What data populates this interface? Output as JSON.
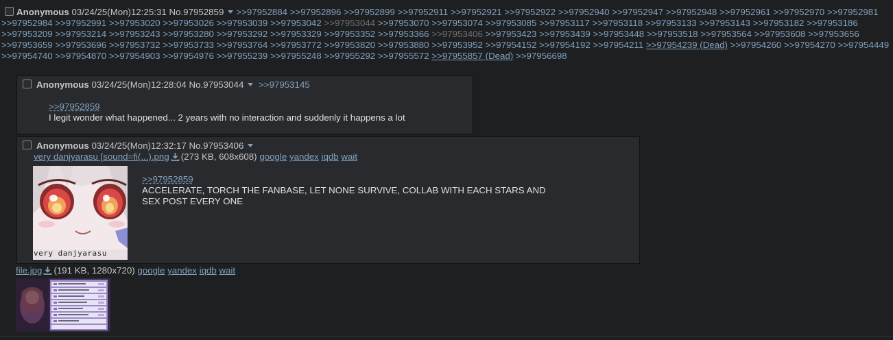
{
  "op": {
    "name": "Anonymous",
    "datetime": "03/24/25(Mon)12:25:31",
    "no": "No.97952859",
    "backlinks": [
      ">>97952884",
      ">>97952896",
      ">>97952899",
      ">>97952911",
      ">>97952921",
      ">>97952922",
      ">>97952940",
      ">>97952947",
      ">>97952948",
      ">>97952961",
      ">>97952970",
      ">>97952981",
      ">>97952984",
      ">>97952991",
      ">>97953020",
      ">>97953026",
      ">>97953039",
      ">>97953042",
      ">>97953044",
      ">>97953070",
      ">>97953074",
      ">>97953085",
      ">>97953117",
      ">>97953118",
      ">>97953133",
      ">>97953143",
      ">>97953182",
      ">>97953186",
      ">>97953209",
      ">>97953214",
      ">>97953243",
      ">>97953280",
      ">>97953292",
      ">>97953329",
      ">>97953352",
      ">>97953366",
      ">>97953406",
      ">>97953423",
      ">>97953439",
      ">>97953448",
      ">>97953518",
      ">>97953564",
      ">>97953608",
      ">>97953656",
      ">>97953659",
      ">>97953696",
      ">>97953732",
      ">>97953733",
      ">>97953764",
      ">>97953772",
      ">>97953820",
      ">>97953880",
      ">>97953952",
      ">>97954152",
      ">>97954192",
      ">>97954211",
      ">>97954239 (Dead)",
      ">>97954260",
      ">>97954270",
      ">>97954449",
      ">>97954740",
      ">>97954870",
      ">>97954903",
      ">>97954976",
      ">>97955239",
      ">>97955248",
      ">>97955292",
      ">>97955572",
      ">>97955857 (Dead)",
      ">>97956698"
    ],
    "file": {
      "name": "file.jpg",
      "info": "(191 KB, 1280x720)",
      "links": [
        "google",
        "yandex",
        "iqdb",
        "wait"
      ]
    }
  },
  "replies": [
    {
      "name": "Anonymous",
      "datetime": "03/24/25(Mon)12:28:04",
      "no": "No.97953044",
      "backlink": ">>97953145",
      "quote": ">>97952859",
      "message": "I legit wonder what happened... 2 years with no interaction and suddenly it happens a lot"
    },
    {
      "name": "Anonymous",
      "datetime": "03/24/25(Mon)12:32:17",
      "no": "No.97953406",
      "file": {
        "name": "very danjyarasu [sound=fi(...).png",
        "info": "(273 KB, 608x608)",
        "links": [
          "google",
          "yandex",
          "iqdb",
          "wait"
        ],
        "thumb_caption": "very danjyarasu"
      },
      "quote": ">>97952859",
      "message_lines": [
        "ACCELERATE, TORCH THE FANBASE, LET NONE SURVIVE, COLLAB WITH EACH STARS AND",
        "SEX POST EVERY ONE"
      ]
    }
  ]
}
